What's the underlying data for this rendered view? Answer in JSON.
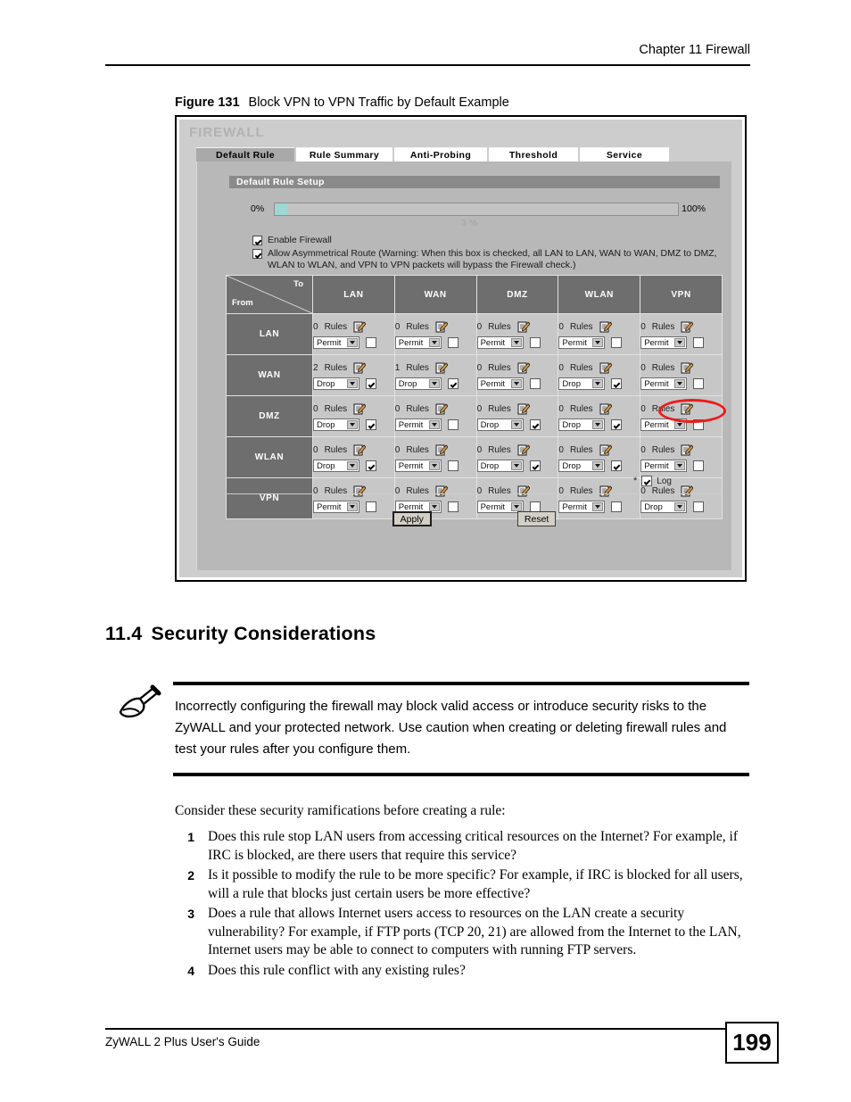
{
  "page": {
    "chapter_header": "Chapter 11 Firewall",
    "footer_title": "ZyWALL 2 Plus User's Guide",
    "page_number": "199"
  },
  "figure": {
    "label": "Figure 131",
    "caption": "Block VPN to VPN Traffic by Default Example"
  },
  "firewall_ui": {
    "app_title": "FIREWALL",
    "tabs": [
      {
        "label": "Default Rule",
        "active": true
      },
      {
        "label": "Rule Summary",
        "active": false
      },
      {
        "label": "Anti-Probing",
        "active": false
      },
      {
        "label": "Threshold",
        "active": false
      },
      {
        "label": "Service",
        "active": false
      }
    ],
    "section_title": "Default Rule Setup",
    "progress": {
      "min_label": "0%",
      "max_label": "100%",
      "value_label": "3 %",
      "percent": 3,
      "fill_color": "#9fd8d2"
    },
    "options": [
      {
        "label": "Enable Firewall",
        "checked": true
      },
      {
        "label": "Allow Asymmetrical Route (Warning: When this box is checked, all LAN to LAN, WAN to WAN, DMZ to DMZ, WLAN to WLAN, and VPN to VPN packets will bypass the Firewall check.)",
        "checked": true
      }
    ],
    "matrix": {
      "corner_to": "To",
      "corner_from": "From",
      "columns": [
        "LAN",
        "WAN",
        "DMZ",
        "WLAN",
        "VPN"
      ],
      "rules_suffix": "Rules",
      "rows": [
        {
          "name": "LAN",
          "cells": [
            {
              "rules": "0",
              "action": "Permit",
              "log": false
            },
            {
              "rules": "0",
              "action": "Permit",
              "log": false
            },
            {
              "rules": "0",
              "action": "Permit",
              "log": false
            },
            {
              "rules": "0",
              "action": "Permit",
              "log": false
            },
            {
              "rules": "0",
              "action": "Permit",
              "log": false
            }
          ]
        },
        {
          "name": "WAN",
          "cells": [
            {
              "rules": "2",
              "action": "Drop",
              "log": true
            },
            {
              "rules": "1",
              "action": "Drop",
              "log": true
            },
            {
              "rules": "0",
              "action": "Permit",
              "log": false
            },
            {
              "rules": "0",
              "action": "Drop",
              "log": true
            },
            {
              "rules": "0",
              "action": "Permit",
              "log": false
            }
          ]
        },
        {
          "name": "DMZ",
          "cells": [
            {
              "rules": "0",
              "action": "Drop",
              "log": true
            },
            {
              "rules": "0",
              "action": "Permit",
              "log": false
            },
            {
              "rules": "0",
              "action": "Drop",
              "log": true
            },
            {
              "rules": "0",
              "action": "Drop",
              "log": true
            },
            {
              "rules": "0",
              "action": "Permit",
              "log": false
            }
          ]
        },
        {
          "name": "WLAN",
          "cells": [
            {
              "rules": "0",
              "action": "Drop",
              "log": true
            },
            {
              "rules": "0",
              "action": "Permit",
              "log": false
            },
            {
              "rules": "0",
              "action": "Drop",
              "log": true
            },
            {
              "rules": "0",
              "action": "Drop",
              "log": true
            },
            {
              "rules": "0",
              "action": "Permit",
              "log": false
            }
          ]
        },
        {
          "name": "VPN",
          "cells": [
            {
              "rules": "0",
              "action": "Permit",
              "log": false
            },
            {
              "rules": "0",
              "action": "Permit",
              "log": false
            },
            {
              "rules": "0",
              "action": "Permit",
              "log": false
            },
            {
              "rules": "0",
              "action": "Permit",
              "log": false
            },
            {
              "rules": "0",
              "action": "Drop",
              "log": false,
              "highlighted": true
            }
          ]
        }
      ]
    },
    "log_note": {
      "star": "*",
      "label": "Log",
      "checked": true
    },
    "buttons": {
      "apply": "Apply",
      "reset": "Reset"
    },
    "highlight_color": "#ee1b19"
  },
  "section": {
    "number": "11.4",
    "title": "Security Considerations"
  },
  "note": {
    "text": "Incorrectly configuring the firewall may block valid access or introduce security risks to the ZyWALL and your protected network. Use caution when creating or deleting firewall rules and test your rules after you configure them."
  },
  "body": {
    "intro": "Consider these security ramifications before creating a rule:",
    "items": [
      {
        "num": "1",
        "text": "Does this rule stop LAN users from accessing critical resources on the Internet? For example, if IRC is blocked, are there users that require this service?"
      },
      {
        "num": "2",
        "text": "Is it possible to modify the rule to be more specific? For example, if IRC is blocked for all users, will a rule that blocks just certain users be more effective?"
      },
      {
        "num": "3",
        "text": "Does a rule that allows Internet users access to resources on the LAN create a security vulnerability? For example, if FTP ports (TCP 20, 21) are allowed from the Internet to the LAN, Internet users may be able to connect to computers with running FTP servers."
      },
      {
        "num": "4",
        "text": "Does this rule conflict with any existing rules?"
      }
    ]
  }
}
